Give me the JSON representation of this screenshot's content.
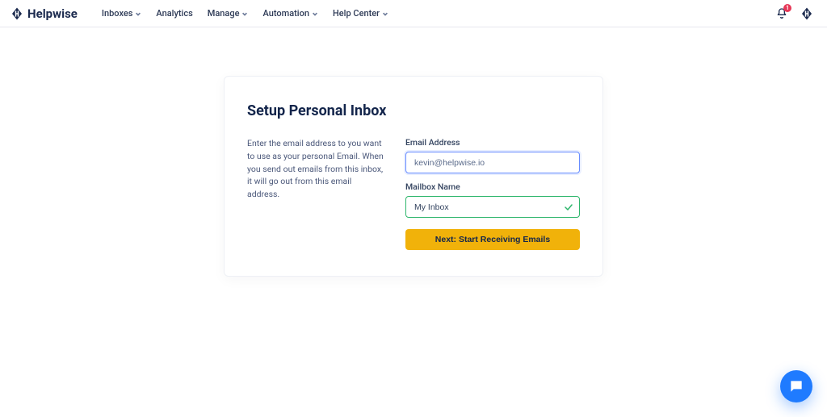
{
  "brand": {
    "name": "Helpwise"
  },
  "nav": {
    "items": [
      {
        "label": "Inboxes",
        "caret": true
      },
      {
        "label": "Analytics",
        "caret": false
      },
      {
        "label": "Manage",
        "caret": true
      },
      {
        "label": "Automation",
        "caret": true
      },
      {
        "label": "Help Center",
        "caret": true
      }
    ],
    "notification_count": "1"
  },
  "card": {
    "title": "Setup Personal Inbox",
    "description": "Enter the email address to you want to use as your personal Email. When you send out emails from this inbox, it will go out from this email address.",
    "email_label": "Email Address",
    "email_value": "kevin@helpwise.io",
    "name_label": "Mailbox Name",
    "name_value": "My Inbox",
    "next_label": "Next: Start Receiving Emails"
  }
}
